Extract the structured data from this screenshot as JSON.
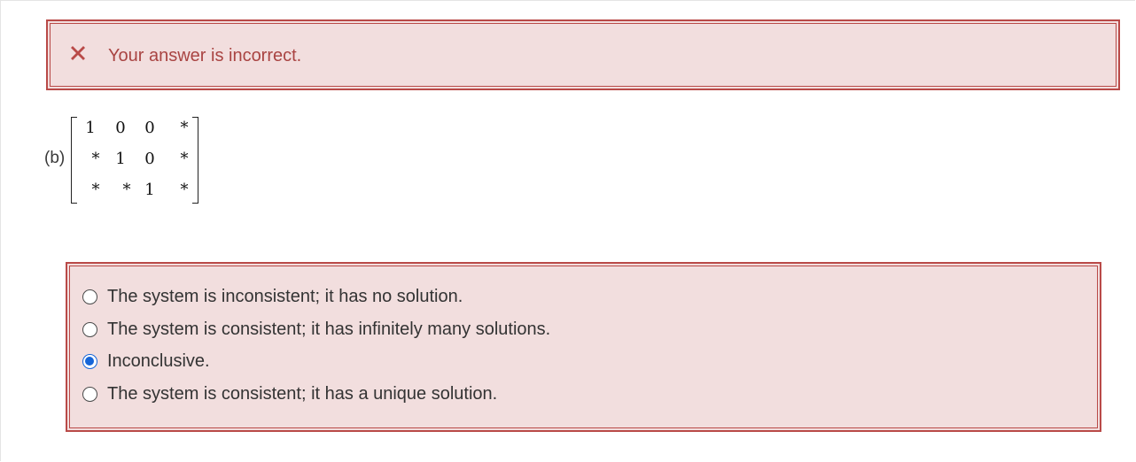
{
  "feedback": {
    "icon": "cross-icon",
    "message": "Your answer is incorrect.",
    "color": "#a94442",
    "background": "#f2dede",
    "border": "#b94a48"
  },
  "question": {
    "part_label": "(b)",
    "matrix": [
      [
        "1",
        "0",
        "0",
        "*"
      ],
      [
        "*",
        "1",
        "0",
        "*"
      ],
      [
        "*",
        "*",
        "1",
        "*"
      ]
    ],
    "options": [
      {
        "label": "The system is inconsistent; it has no solution.",
        "selected": false
      },
      {
        "label": "The system is consistent; it has infinitely many solutions.",
        "selected": false
      },
      {
        "label": "Inconclusive.",
        "selected": true
      },
      {
        "label": "The system is consistent; it has a unique solution.",
        "selected": false
      }
    ],
    "selected_color": "#1565d8"
  }
}
